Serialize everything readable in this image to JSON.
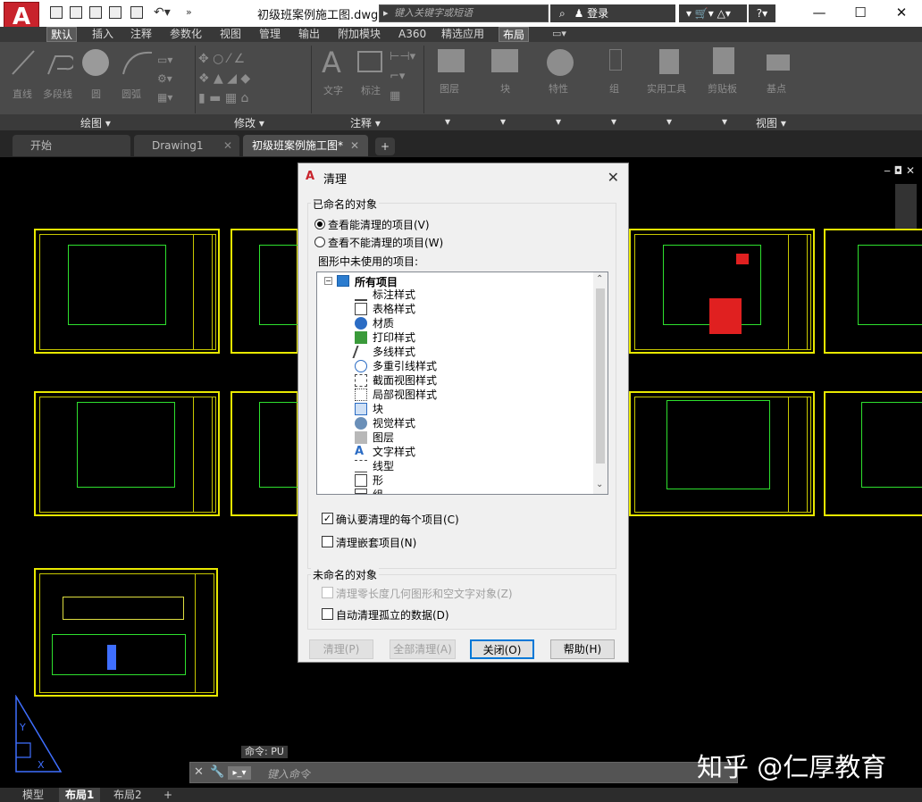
{
  "titlebar": {
    "file_title": "初级班案例施工图.dwg",
    "search_placeholder": "键入关键字或短语",
    "login": "登录",
    "minimize": "—",
    "maximize": "☐",
    "close": "✕"
  },
  "ribbon_tabs": [
    "默认",
    "插入",
    "注释",
    "参数化",
    "视图",
    "管理",
    "输出",
    "附加模块",
    "A360",
    "精选应用",
    "布局"
  ],
  "ribbon_buttons": {
    "line": "直线",
    "polyline": "多段线",
    "circle": "圆",
    "arc": "圆弧",
    "text": "文字",
    "dim": "标注",
    "layers": "图层",
    "block": "块",
    "props": "特性",
    "group": "组",
    "utilities": "实用工具",
    "clipboard": "剪贴板",
    "base": "基点"
  },
  "panels": {
    "draw": "绘图 ▾",
    "modify": "修改 ▾",
    "annotation": "注释 ▾",
    "view": "视图 ▾"
  },
  "doc_tabs": {
    "start": "开始",
    "drawing1": "Drawing1",
    "current": "初级班案例施工图*"
  },
  "dialog": {
    "title": "清理",
    "named_group": "已命名的对象",
    "radio_purgeable": "查看能清理的项目(V)",
    "radio_nonpurgeable": "查看不能清理的项目(W)",
    "tree_label": "图形中未使用的项目:",
    "tree_root": "所有项目",
    "tree_items": [
      "标注样式",
      "表格样式",
      "材质",
      "打印样式",
      "多线样式",
      "多重引线样式",
      "截面视图样式",
      "局部视图样式",
      "块",
      "视觉样式",
      "图层",
      "文字样式",
      "线型",
      "形",
      "组"
    ],
    "confirm_each": "确认要清理的每个项目(C)",
    "purge_nested": "清理嵌套项目(N)",
    "unnamed_group": "未命名的对象",
    "zero_length": "清理零长度几何图形和空文字对象(Z)",
    "orphan_data": "自动清理孤立的数据(D)",
    "btn_purge": "清理(P)",
    "btn_purge_all": "全部清理(A)",
    "btn_close": "关闭(O)",
    "btn_help": "帮助(H)"
  },
  "command": {
    "history": "命令: PU",
    "placeholder": "键入命令"
  },
  "status_tabs": [
    "模型",
    "布局1",
    "布局2"
  ],
  "watermark": "知乎 @仁厚教育"
}
